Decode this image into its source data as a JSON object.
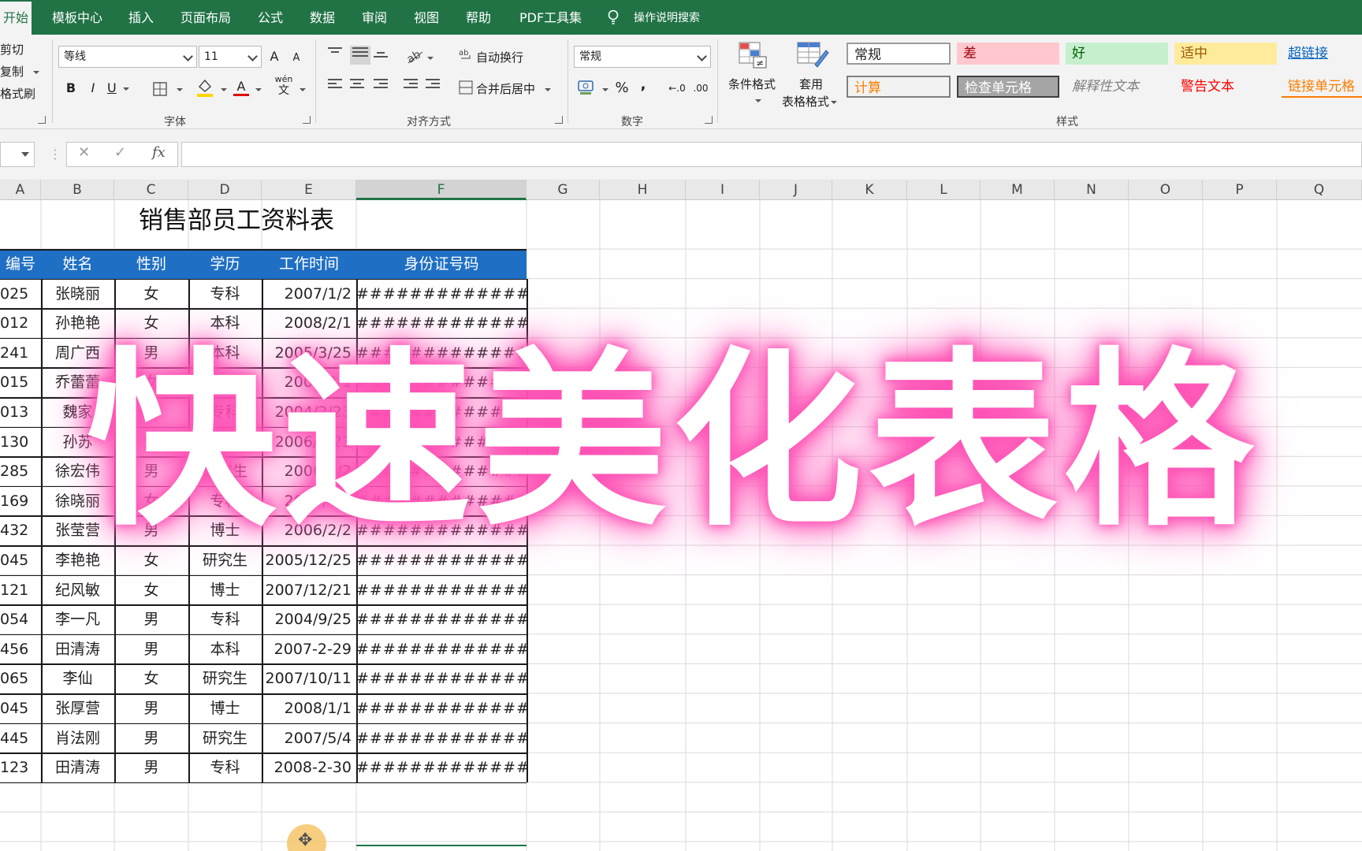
{
  "tabs": [
    "开始",
    "模板中心",
    "插入",
    "页面布局",
    "公式",
    "数据",
    "审阅",
    "视图",
    "帮助",
    "PDF工具集"
  ],
  "tell_me": "操作说明搜索",
  "clipboard": {
    "cut": "剪切",
    "copy": "复制",
    "format_painter": "格式刷"
  },
  "font": {
    "name": "等线",
    "size": "11",
    "grow": "A",
    "shrink": "A",
    "bold": "B",
    "italic": "I",
    "underline": "U",
    "font_color": "A",
    "phonetic": "wén",
    "group": "字体"
  },
  "alignment": {
    "wrap": "自动换行",
    "merge": "合并后居中",
    "group": "对齐方式"
  },
  "number": {
    "format": "常规",
    "percent": "%",
    "comma": ",",
    "inc_decimal": "←.0",
    "dec_decimal": ".00",
    "group": "数字"
  },
  "styles": {
    "conditional": "条件格式",
    "table_line1": "套用",
    "table_line2": "表格格式",
    "group": "样式",
    "cells": [
      {
        "label": "常规",
        "color": "#222222",
        "bg": "#ffffff",
        "border": "#9b9b9b"
      },
      {
        "label": "差",
        "color": "#9c0006",
        "bg": "#ffc7ce",
        "border": "none"
      },
      {
        "label": "好",
        "color": "#006100",
        "bg": "#c6efce",
        "border": "none"
      },
      {
        "label": "适中",
        "color": "#9c5700",
        "bg": "#ffeb9c",
        "border": "none"
      },
      {
        "label": "超链接",
        "color": "#0563c1",
        "bg": "transparent",
        "border": "none"
      },
      {
        "label": "计算",
        "color": "#fa7d00",
        "bg": "#f2f2f2",
        "border": "#7f7f7f"
      },
      {
        "label": "检查单元格",
        "color": "#ffffff",
        "bg": "#a5a5a5",
        "border": "#3f3f3f"
      },
      {
        "label": "解释性文本",
        "color": "#7f7f7f",
        "bg": "transparent",
        "border": "none"
      },
      {
        "label": "警告文本",
        "color": "#ff0000",
        "bg": "transparent",
        "border": "none"
      },
      {
        "label": "链接单元格",
        "color": "#fa7d00",
        "bg": "transparent",
        "border": "none"
      }
    ]
  },
  "formula_bar": {
    "fx": "fx",
    "cancel": "✕",
    "enter": "✓"
  },
  "columns": [
    "A",
    "B",
    "C",
    "D",
    "E",
    "F",
    "G",
    "H",
    "I",
    "J",
    "K",
    "L",
    "M",
    "N",
    "O",
    "P",
    "Q"
  ],
  "selected_column": "F",
  "table": {
    "title": "销售部员工资料表",
    "headers": [
      "编号",
      "姓名",
      "性别",
      "学历",
      "工作时间",
      "身份证号码"
    ],
    "header_bg": "#1f6fc4",
    "rows": [
      [
        "025",
        "张晓丽",
        "女",
        "专科",
        "2007/1/2",
        "################"
      ],
      [
        "012",
        "孙艳艳",
        "女",
        "本科",
        "2008/2/1",
        "################"
      ],
      [
        "241",
        "周广西",
        "男",
        "本科",
        "2005/3/25",
        "################"
      ],
      [
        "015",
        "乔蕾蕾",
        "女",
        "专科",
        "2007/2/1",
        "################"
      ],
      [
        "013",
        "魏家",
        "男",
        "专科",
        "2004/2/23",
        "################"
      ],
      [
        "130",
        "孙苏",
        "女",
        "本科",
        "2006/2/23",
        "################"
      ],
      [
        "285",
        "徐宏伟",
        "男",
        "研究生",
        "2006/2/2",
        "################"
      ],
      [
        "169",
        "徐晓丽",
        "女",
        "专科",
        "2007/4/1",
        "################"
      ],
      [
        "432",
        "张莹营",
        "男",
        "博士",
        "2006/2/2",
        "################"
      ],
      [
        "045",
        "李艳艳",
        "女",
        "研究生",
        "2005/12/25",
        "################"
      ],
      [
        "121",
        "纪风敏",
        "女",
        "博士",
        "2007/12/21",
        "################"
      ],
      [
        "054",
        "李一凡",
        "男",
        "专科",
        "2004/9/25",
        "################"
      ],
      [
        "456",
        "田清涛",
        "男",
        "本科",
        "2007-2-29",
        "################"
      ],
      [
        "065",
        "李仙",
        "女",
        "研究生",
        "2007/10/11",
        "################"
      ],
      [
        "045",
        "张厚营",
        "男",
        "博士",
        "2008/1/1",
        "################"
      ],
      [
        "445",
        "肖法刚",
        "男",
        "研究生",
        "2007/5/4",
        "################"
      ],
      [
        "123",
        "田清涛",
        "男",
        "专科",
        "2008-2-30",
        "################"
      ]
    ]
  },
  "overlay_text": "快速美化表格",
  "accent": "#217346"
}
